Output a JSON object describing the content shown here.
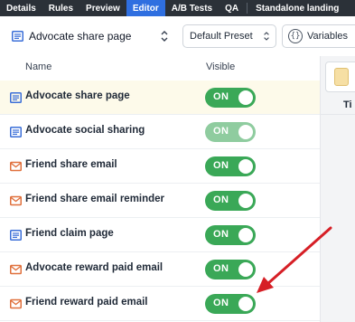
{
  "topnav": {
    "tabs": [
      {
        "label": "Details"
      },
      {
        "label": "Rules"
      },
      {
        "label": "Preview"
      },
      {
        "label": "Editor",
        "active": true
      },
      {
        "label": "A/B Tests"
      },
      {
        "label": "QA"
      },
      {
        "label": "Standalone landing"
      }
    ],
    "active_color": "#2f6fe0"
  },
  "toolbar": {
    "page_select_label": "Advocate share page",
    "preset_label": "Default Preset",
    "variables_label": "Variables"
  },
  "table": {
    "col_name": "Name",
    "col_visible": "Visible",
    "toggle_label": "ON",
    "rows": [
      {
        "label": "Advocate share page",
        "icon": "page-icon",
        "selected": true
      },
      {
        "label": "Advocate social sharing",
        "icon": "page-icon"
      },
      {
        "label": "Friend share email",
        "icon": "email-icon"
      },
      {
        "label": "Friend share email reminder",
        "icon": "email-icon"
      },
      {
        "label": "Friend claim page",
        "icon": "page-icon"
      },
      {
        "label": "Advocate reward paid email",
        "icon": "email-icon"
      },
      {
        "label": "Friend reward paid email",
        "icon": "email-icon"
      }
    ]
  },
  "right_panel": {
    "heading": "Ti"
  },
  "colors": {
    "toggle_on": "#3aa857",
    "page_icon": "#3b6fd8",
    "email_icon": "#e0703c",
    "arrow": "#d61f26"
  }
}
